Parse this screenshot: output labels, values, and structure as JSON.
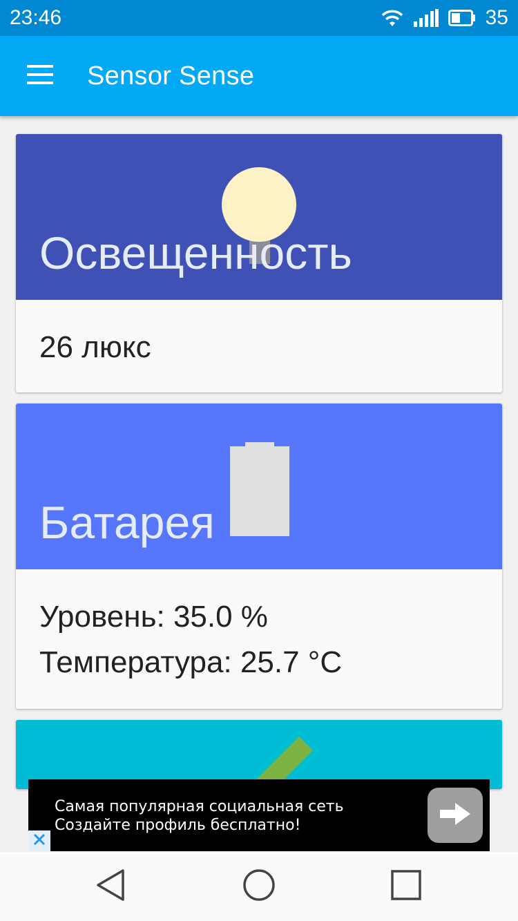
{
  "status_bar": {
    "time": "23:46",
    "battery_level": "35",
    "icons": [
      "wifi-icon",
      "signal-icon",
      "battery-icon"
    ]
  },
  "app_bar": {
    "title": "Sensor Sense",
    "menu_icon": "hamburger-menu-icon"
  },
  "cards": [
    {
      "title": "Освещенность",
      "icon": "lightbulb-icon",
      "header_color": "#3f51b5",
      "lines": [
        "26 люкс"
      ]
    },
    {
      "title": "Батарея",
      "icon": "battery-icon",
      "header_color": "#5677fc",
      "lines": [
        "Уровень: 35.0 %",
        "Температура: 25.7 °C"
      ]
    },
    {
      "title": "",
      "icon": "pencil-icon",
      "header_color": "#00bcd4",
      "lines": []
    }
  ],
  "ad": {
    "line1": "Самая популярная социальная сеть",
    "line2": "Создайте профиль бесплатно!",
    "arrow_icon": "arrow-right-icon",
    "close_icon": "close-icon"
  },
  "nav_bar": {
    "buttons": [
      "back-icon",
      "home-icon",
      "recents-icon"
    ]
  },
  "colors": {
    "status_bar": "#0288d1",
    "app_bar": "#03a9f4"
  }
}
